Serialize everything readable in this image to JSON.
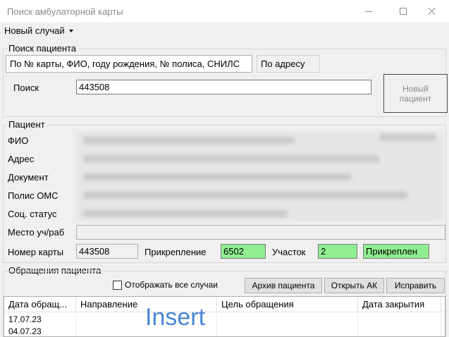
{
  "window": {
    "title": "Поиск амбулаторной карты"
  },
  "menu": {
    "new_case": "Новый случай"
  },
  "search_group": {
    "title": "Поиск пациента",
    "tabs": [
      {
        "label": "По № карты, ФИО, году рождения, № полиса, СНИЛС",
        "active": true
      },
      {
        "label": "По адресу",
        "active": false
      }
    ],
    "search_label": "Поиск",
    "search_value": "443508",
    "new_patient_button": "Новый пациент"
  },
  "patient_group": {
    "title": "Пациент",
    "fields": {
      "fio": "ФИО",
      "address": "Адрес",
      "document": "Документ",
      "policy": "Полис ОМС",
      "social_status": "Соц. статус",
      "workplace": "Место уч/раб"
    },
    "card_number_label": "Номер карты",
    "card_number_value": "443508",
    "attachment_label": "Прикрепление",
    "attachment_value": "6502",
    "district_label": "Участок",
    "district_value": "2",
    "attached_status": "Прикреплен"
  },
  "visits_group": {
    "title": "Обращения пациента",
    "show_all_label": "Отображать все случаи",
    "show_all_checked": false,
    "buttons": {
      "archive": "Архив пациента",
      "open_ak": "Открыть АК",
      "fix": "Исправить"
    },
    "columns": [
      "Дата обращ...",
      "Направление",
      "Цель обращения",
      "Дата закрытия"
    ],
    "rows": [
      [
        "17.07.23",
        "",
        "",
        ""
      ],
      [
        "04.07.23",
        "",
        "",
        ""
      ]
    ]
  },
  "overlay_text": "Insert",
  "colors": {
    "green_field": "#90ee90",
    "insert_text": "#4a86d4"
  }
}
